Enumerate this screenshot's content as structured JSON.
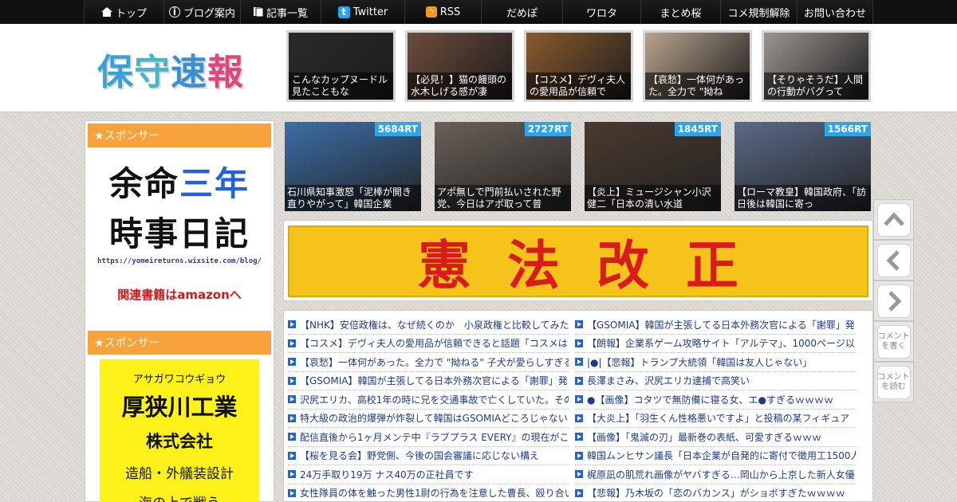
{
  "nav": {
    "items": [
      {
        "label": "トップ",
        "icon": "home-icon"
      },
      {
        "label": "ブログ案内",
        "icon": "info-icon"
      },
      {
        "label": "記事一覧",
        "icon": "list-icon"
      },
      {
        "label": "Twitter",
        "icon": "twitter-icon"
      },
      {
        "label": "RSS",
        "icon": "rss-icon"
      },
      {
        "label": "だめぽ"
      },
      {
        "label": "ワロタ"
      },
      {
        "label": "まとめ桜"
      },
      {
        "label": "コメ規制解除"
      },
      {
        "label": "お問い合わせ"
      }
    ]
  },
  "header": {
    "logo": {
      "c1": "保",
      "c2": "守",
      "c3": "速",
      "c4": "報"
    },
    "thumbs": [
      {
        "caption": "こんなカップヌードル見たこともな",
        "color": "#2a2a2a"
      },
      {
        "caption": "【必見！】猫の饅頭の水木しげる感が凄",
        "color": "#6e4b3a"
      },
      {
        "caption": "【コスメ】デヴィ夫人の愛用品が信頼で",
        "color": "#8a5a2e"
      },
      {
        "caption": "【哀愁】一体何があった。全力で \"拗ね",
        "color": "#b9a48e"
      },
      {
        "caption": "【そりゃそうだ】人間の行動がバグって",
        "color": "#9a9590"
      }
    ]
  },
  "sidebar": {
    "sponsor1": "★スポンサー",
    "ad1": {
      "line1a": "余命",
      "line1b": "三年",
      "line2": "時事日記",
      "url": "https://yomeireturns.wixsite.com/blog/",
      "amazon": "関連書籍はamazonへ"
    },
    "sponsor2": "★スポンサー",
    "ad2": {
      "kana": "アサガワコウギョウ",
      "name": "厚狭川工業",
      "corp": "株式会社",
      "biz": "造船・外艤装設計",
      "more": "海の上で戦う"
    }
  },
  "rt": [
    {
      "count": "5684RT",
      "caption": "石川県知事激怒「泥棒が開き直りやがって」韓国企業",
      "color": "#3c6ea8"
    },
    {
      "count": "2727RT",
      "caption": "アポ無しで門前払いされた野党、今日はアポ取って普",
      "color": "#6a6058"
    },
    {
      "count": "1845RT",
      "caption": "【炎上】ミュージシャン小沢健二「日本の清い水道",
      "color": "#4a3a2e"
    },
    {
      "count": "1566RT",
      "caption": "【ローマ教皇】韓国政府、「訪日後は韓国に寄っ",
      "color": "#5a6a88"
    }
  ],
  "banner": {
    "chars": [
      "憲",
      "法",
      "改",
      "正"
    ]
  },
  "list_left": [
    "【NHK】安倍政権は、なぜ続くのか　小泉政権と比較してみた",
    "【コスメ】デヴィ夫人の愛用品が信頼できると話題「コスメは",
    "【哀愁】一体何があった。全力で \"拗ねる\" 子犬が愛らしすぎる",
    "【GSOMIA】韓国が主張してる日本外務次官による「謝罪」発",
    "沢尻エリカ、高校1年の時に兄を交通事故で亡くしていた。その",
    "特大級の政治的爆弾が炸裂して韓国はGSOMIAどころじゃない",
    "配信直後から1ヶ月メンテ中『ラブプラス EVERY』の現在がこ",
    "【桜を見る会】野党側、今後の国会審議に応じない構え",
    "24万手取り19万 ナス40万の正社員です",
    "女性隊員の体を触った男性1尉の行為を注意した曹長、殴り合い"
  ],
  "list_right": [
    "【GSOMIA】韓国が主張してる日本外務次官による「謝罪」発",
    "【朗報】企業系ゲーム攻略サイト「アルテマ」、1000ページ以",
    "|●|【悲報】トランプ大統領「韓国は友人じゃない」",
    "長澤まさみ、沢尻エリカ逮捕で高笑い",
    "●【画像】コタツで無防備に寝る女、エ●すぎるｗｗｗｗ",
    "【大炎上】「羽生くん性格悪いですよ」と投稿の某フィギュア",
    "【画像】「鬼滅の刃」最新巻の表紙、可愛すぎるｗｗｗ",
    "韓国ムンヒサン議長「日本企業が自発的に寄付で徴用工1500人",
    "梶原凪の肌荒れ画像がヤバすぎる…岡山から上京した新人女優",
    "【悲報】乃木坂の「恋のバカンス」がショボすぎたｗｗｗｗ"
  ],
  "float": {
    "comment_write": "コメントを書く",
    "comment_read": "コメントを読む"
  }
}
